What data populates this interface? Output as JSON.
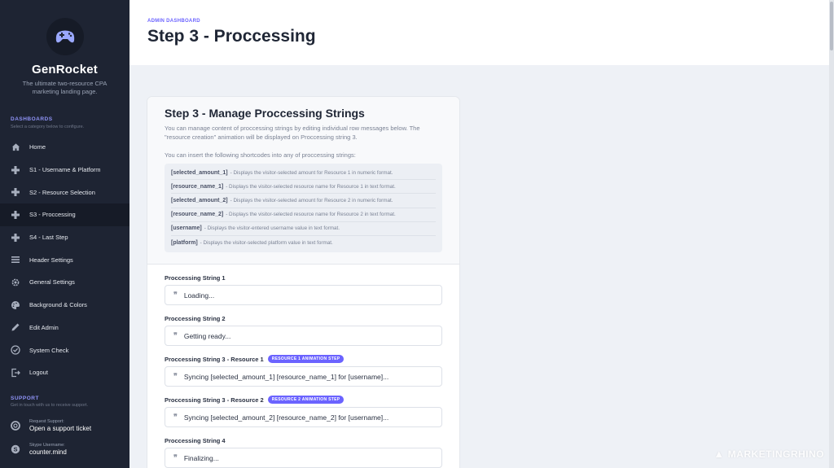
{
  "brand": {
    "name": "GenRocket",
    "tagline": "The ultimate two-resource CPA marketing landing page."
  },
  "sidebar": {
    "section_title": "DASHBOARDS",
    "section_subtitle": "Select a category below to configure.",
    "items": [
      {
        "label": "Home",
        "icon": "home-icon"
      },
      {
        "label": "S1 - Username & Platform",
        "icon": "gamepad-icon"
      },
      {
        "label": "S2 - Resource Selection",
        "icon": "gamepad-icon"
      },
      {
        "label": "S3 - Proccessing",
        "icon": "gamepad-icon",
        "active": true
      },
      {
        "label": "S4 - Last Step",
        "icon": "gamepad-icon"
      },
      {
        "label": "Header Settings",
        "icon": "header-icon"
      },
      {
        "label": "General Settings",
        "icon": "gear-icon"
      },
      {
        "label": "Background & Colors",
        "icon": "palette-icon"
      },
      {
        "label": "Edit Admin",
        "icon": "pencil-icon"
      },
      {
        "label": "System Check",
        "icon": "check-circle-icon"
      },
      {
        "label": "Logout",
        "icon": "logout-icon"
      }
    ],
    "support": {
      "title": "SUPPORT",
      "subtitle": "Get in touch with us to receive support.",
      "request_small": "Request Support:",
      "request_big": "Open a support ticket",
      "skype_small": "Skype Username:",
      "skype_big": "counter.mind"
    }
  },
  "header": {
    "crumb": "ADMIN DASHBOARD",
    "title": "Step 3 - Proccessing"
  },
  "card": {
    "title": "Step 3 - Manage Proccessing Strings",
    "desc": "You can manage content of proccessing strings by editing individual row messages below. The \"resource creation\" animation will be displayed on Proccessing string 3.",
    "desc2": "You can insert the following shortcodes into any of proccessing strings:",
    "shortcodes": [
      {
        "code": "[selected_amount_1]",
        "text": "- Displays the visitor-selected amount for Resource 1 in numeric format."
      },
      {
        "code": "[resource_name_1]",
        "text": "- Displays the visitor-selected resource name for Resource 1 in text format."
      },
      {
        "code": "[selected_amount_2]",
        "text": "- Displays the visitor-selected amount for Resource 2 in numeric format."
      },
      {
        "code": "[resource_name_2]",
        "text": "- Displays the visitor-selected resource name for Resource 2 in text format."
      },
      {
        "code": "[username]",
        "text": "- Displays the visitor-entered username value in text format."
      },
      {
        "code": "[platform]",
        "text": "- Displays the visitor-selected platform value in text format."
      }
    ],
    "fields": [
      {
        "label": "Proccessing String 1",
        "badge": "",
        "value": "Loading..."
      },
      {
        "label": "Proccessing String 2",
        "badge": "",
        "value": "Getting ready..."
      },
      {
        "label": "Proccessing String 3 - Resource 1",
        "badge": "RESOURCE 1 ANIMATION STEP",
        "value": "Syncing [selected_amount_1] [resource_name_1] for [username]..."
      },
      {
        "label": "Proccessing String 3 - Resource 2",
        "badge": "RESOURCE 2 ANIMATION STEP",
        "value": "Syncing [selected_amount_2] [resource_name_2] for [username]..."
      },
      {
        "label": "Proccessing String 4",
        "badge": "",
        "value": "Finalizing..."
      }
    ]
  },
  "watermark": "MARKETINGRHINO",
  "colors": {
    "accent": "#6b63ff",
    "sidebar": "#1e2433"
  }
}
